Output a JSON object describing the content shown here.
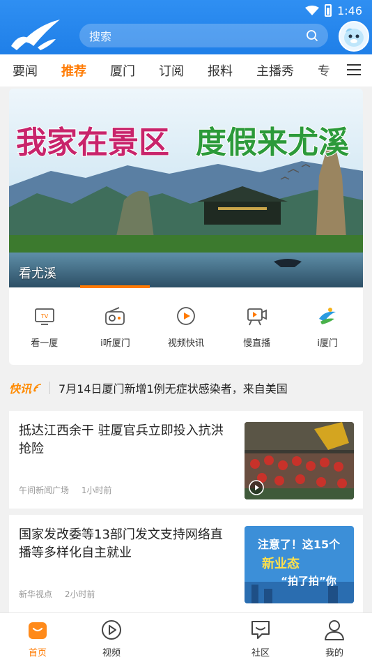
{
  "status": {
    "time": "1:46"
  },
  "search": {
    "placeholder": "搜索"
  },
  "tabs": [
    {
      "label": "要闻"
    },
    {
      "label": "推荐",
      "active": true
    },
    {
      "label": "厦门"
    },
    {
      "label": "订阅"
    },
    {
      "label": "报料"
    },
    {
      "label": "主播秀"
    },
    {
      "label": "专"
    }
  ],
  "banner": {
    "headline_left": "我家在景区",
    "headline_right": "度假来尤溪",
    "caption": "看尤溪"
  },
  "quick": [
    {
      "label": "看一厦",
      "icon": "tv-icon"
    },
    {
      "label": "i听厦门",
      "icon": "radio-icon"
    },
    {
      "label": "视频快讯",
      "icon": "video-flash-icon"
    },
    {
      "label": "慢直播",
      "icon": "live-stream-icon"
    },
    {
      "label": "i厦门",
      "icon": "ixiamen-logo-icon"
    }
  ],
  "flash": {
    "badge": "快讯",
    "text": "7月14日厦门新增1例无症状感染者，来自美国"
  },
  "articles": [
    {
      "title": "抵达江西余干 驻厦官兵立即投入抗洪抢险",
      "source": "午间新闻广场",
      "time": "1小时前",
      "has_video": true
    },
    {
      "title": "国家发改委等13部门发文支持网络直播等多样化自主就业",
      "source": "新华视点",
      "time": "2小时前",
      "thumb_line1": "注意了！这15个",
      "thumb_line2": "新业态",
      "thumb_line3": "“拍了拍”你"
    }
  ],
  "bottom_nav": [
    {
      "label": "首页",
      "active": true,
      "icon": "home-icon"
    },
    {
      "label": "视频",
      "icon": "video-icon"
    },
    {
      "label": "社区",
      "icon": "community-icon"
    },
    {
      "label": "我的",
      "icon": "profile-icon"
    }
  ],
  "colors": {
    "brand_blue": "#1f7fe8",
    "accent_orange": "#ff7a00"
  }
}
